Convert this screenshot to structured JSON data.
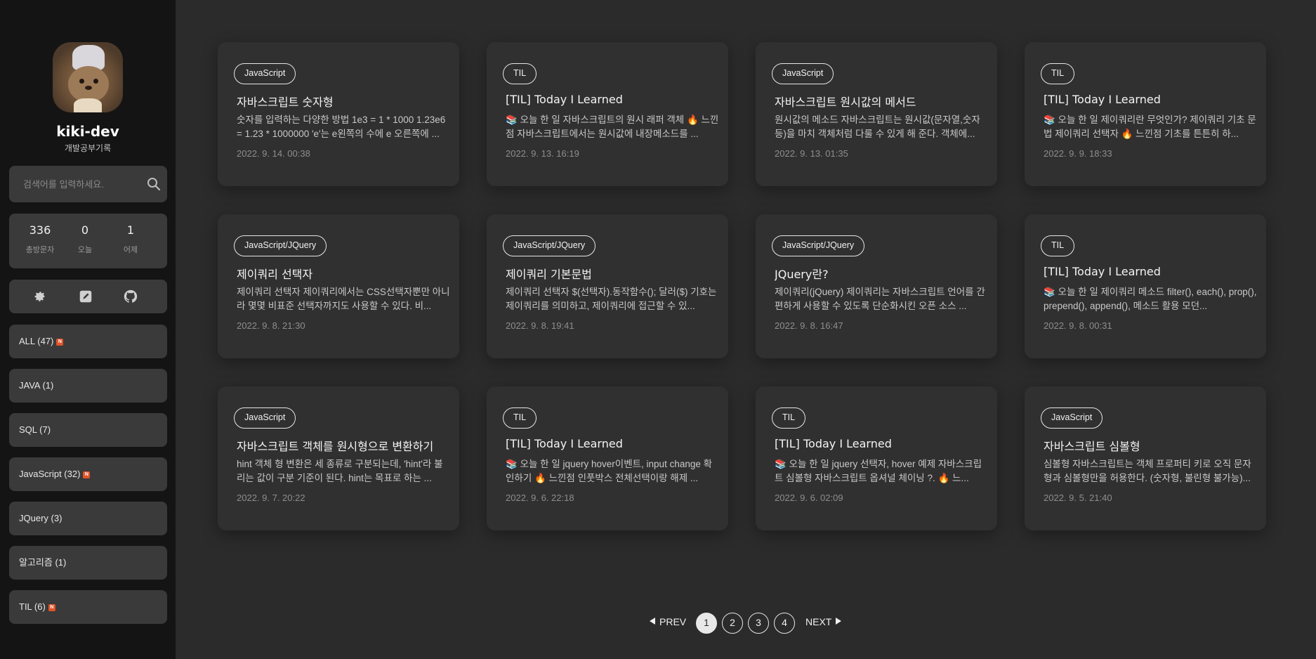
{
  "sidebar": {
    "blog_title": "kiki-dev",
    "blog_subtitle": "개발공부기록",
    "search_placeholder": "검색어를 입력하세요.",
    "stats": [
      {
        "value": "336",
        "label": "총방문자"
      },
      {
        "value": "0",
        "label": "오늘"
      },
      {
        "value": "1",
        "label": "어제"
      }
    ],
    "icons": [
      "gear-icon",
      "edit-icon",
      "github-icon"
    ],
    "categories": [
      {
        "label": "ALL (47)",
        "new": true
      },
      {
        "label": "JAVA (1)",
        "new": false
      },
      {
        "label": "SQL (7)",
        "new": false
      },
      {
        "label": "JavaScript (32)",
        "new": true
      },
      {
        "label": "JQuery (3)",
        "new": false
      },
      {
        "label": "알고리즘 (1)",
        "new": false
      },
      {
        "label": "TIL (6)",
        "new": true
      }
    ],
    "new_badge": "N"
  },
  "posts": [
    {
      "tag": "JavaScript",
      "title": "자바스크립트 숫자형",
      "desc": "숫자를 입력하는 다양한 방법 1e3 = 1 * 1000 1.23e6 = 1.23 * 1000000 'e'는 e왼쪽의 수에 e 오른쪽에 ...",
      "date": "2022. 9. 14. 00:38"
    },
    {
      "tag": "TIL",
      "title": "[TIL] Today I Learned",
      "desc": "📚 오늘 한 일 자바스크립트의 원시 래퍼 객체 🔥 느낀점 자바스크립트에서는 원시값에 내장메소드를 ...",
      "date": "2022. 9. 13. 16:19"
    },
    {
      "tag": "JavaScript",
      "title": "자바스크립트 원시값의 메서드",
      "desc": "원시값의 메소드 자바스크립트는 원시값(문자열,숫자 등)을 마치 객체처럼 다룰 수 있게 해 준다. 객체에...",
      "date": "2022. 9. 13. 01:35"
    },
    {
      "tag": "TIL",
      "title": "[TIL] Today I Learned",
      "desc": "📚 오늘 한 일 제이쿼리란 무엇인가? 제이쿼리 기초 문법 제이쿼리 선택자 🔥 느낀점 기초를 튼튼히 하...",
      "date": "2022. 9. 9. 18:33"
    },
    {
      "tag": "JavaScript/JQuery",
      "title": "제이쿼리 선택자",
      "desc": "제이쿼리 선택자 제이쿼리에서는 CSS선택자뿐만 아니라 몇몇 비표준 선택자까지도 사용할 수 있다. 비...",
      "date": "2022. 9. 8. 21:30"
    },
    {
      "tag": "JavaScript/JQuery",
      "title": "제이쿼리 기본문법",
      "desc": "제이쿼리 선택자 $(선택자).동작함수(); 달러($) 기호는 제이쿼리를 의미하고, 제이쿼리에 접근할 수 있...",
      "date": "2022. 9. 8. 19:41"
    },
    {
      "tag": "JavaScript/JQuery",
      "title": "JQuery란?",
      "desc": "제이쿼리(jQuery) 제이쿼리는 자바스크립트 언어를 간편하게 사용할 수 있도록 단순화시킨 오픈 소스 ...",
      "date": "2022. 9. 8. 16:47"
    },
    {
      "tag": "TIL",
      "title": "[TIL] Today I Learned",
      "desc": "📚 오늘 한 일 제이쿼리 메소드 filter(), each(), prop(), prepend(), append(), 메소드 활용 모던...",
      "date": "2022. 9. 8. 00:31"
    },
    {
      "tag": "JavaScript",
      "title": "자바스크립트 객체를 원시형으로 변환하기",
      "desc": "hint 객체 형 변환은 세 종류로 구분되는데, 'hint'라 불리는 값이 구분 기준이 된다. hint는 목표로 하는 ...",
      "date": "2022. 9. 7. 20:22"
    },
    {
      "tag": "TIL",
      "title": "[TIL] Today I Learned",
      "desc": "📚 오늘 한 일 jquery hover이벤트, input change 확인하기 🔥 느낀점 인풋박스 전체선택이랑 해제 ...",
      "date": "2022. 9. 6. 22:18"
    },
    {
      "tag": "TIL",
      "title": "[TIL] Today I Learned",
      "desc": "📚 오늘 한 일 jquery 선택자, hover 예제 자바스크립트 심볼형 자바스크립트 옵셔널 체이닝 ?. 🔥 느...",
      "date": "2022. 9. 6. 02:09"
    },
    {
      "tag": "JavaScript",
      "title": "자바스크립트 심볼형",
      "desc": "심볼형 자바스크립트는 객체 프로퍼티 키로 오직 문자형과 심볼형만을 허용한다. (숫자형, 불린형 불가능)...",
      "date": "2022. 9. 5. 21:40"
    }
  ],
  "pagination": {
    "prev_label": "PREV",
    "next_label": "NEXT",
    "pages": [
      "1",
      "2",
      "3",
      "4"
    ],
    "current": "1"
  },
  "colors": {
    "background": "#2b2b2b",
    "sidebar": "#141414",
    "panel": "#3a3a3a",
    "card": "#303030",
    "new_badge": "#e0552a"
  }
}
